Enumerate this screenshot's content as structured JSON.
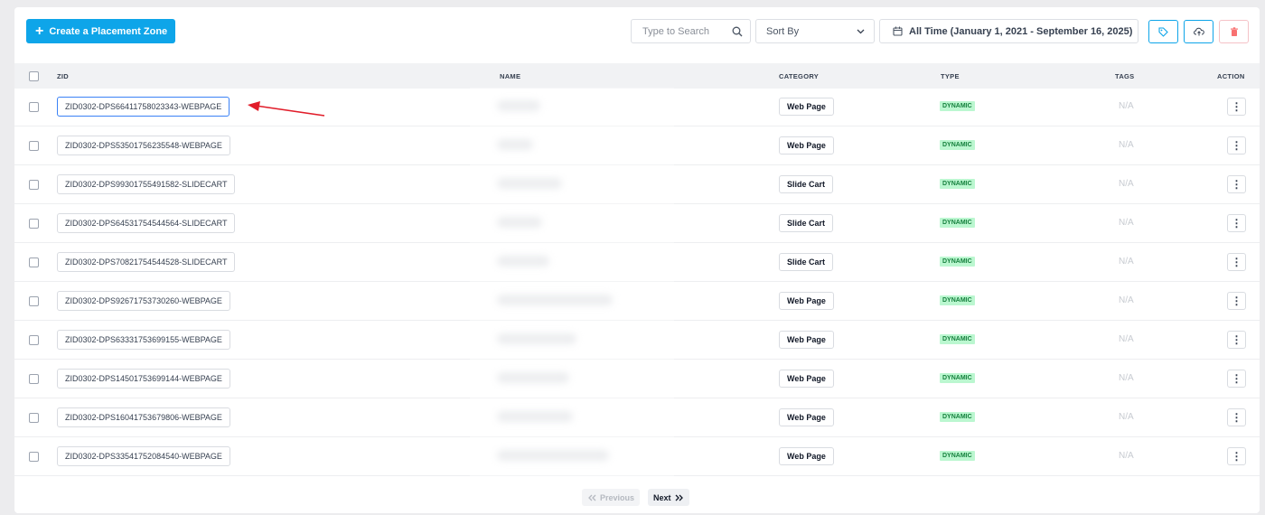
{
  "toolbar": {
    "create_label": "Create a Placement Zone",
    "search_placeholder": "Type to Search",
    "sort_label": "Sort By",
    "date_range": "All Time (January 1, 2021 - September 16, 2025)"
  },
  "table": {
    "columns": {
      "zid": "ZID",
      "name": "NAME",
      "category": "CATEGORY",
      "type": "TYPE",
      "tags": "TAGS",
      "action": "ACTION"
    },
    "rows": [
      {
        "zid": "ZID0302-DPS66411758023343-WEBPAGE",
        "category": "Web Page",
        "type": "DYNAMIC",
        "tags": "N/A"
      },
      {
        "zid": "ZID0302-DPS53501756235548-WEBPAGE",
        "category": "Web Page",
        "type": "DYNAMIC",
        "tags": "N/A"
      },
      {
        "zid": "ZID0302-DPS99301755491582-SLIDECART",
        "category": "Slide Cart",
        "type": "DYNAMIC",
        "tags": "N/A"
      },
      {
        "zid": "ZID0302-DPS64531754544564-SLIDECART",
        "category": "Slide Cart",
        "type": "DYNAMIC",
        "tags": "N/A"
      },
      {
        "zid": "ZID0302-DPS70821754544528-SLIDECART",
        "category": "Slide Cart",
        "type": "DYNAMIC",
        "tags": "N/A"
      },
      {
        "zid": "ZID0302-DPS92671753730260-WEBPAGE",
        "category": "Web Page",
        "type": "DYNAMIC",
        "tags": "N/A"
      },
      {
        "zid": "ZID0302-DPS63331753699155-WEBPAGE",
        "category": "Web Page",
        "type": "DYNAMIC",
        "tags": "N/A"
      },
      {
        "zid": "ZID0302-DPS14501753699144-WEBPAGE",
        "category": "Web Page",
        "type": "DYNAMIC",
        "tags": "N/A"
      },
      {
        "zid": "ZID0302-DPS16041753679806-WEBPAGE",
        "category": "Web Page",
        "type": "DYNAMIC",
        "tags": "N/A"
      },
      {
        "zid": "ZID0302-DPS33541752084540-WEBPAGE",
        "category": "Web Page",
        "type": "DYNAMIC",
        "tags": "N/A"
      }
    ]
  },
  "pagination": {
    "previous_label": "Previous",
    "next_label": "Next"
  },
  "colors": {
    "primary": "#0ea5e9",
    "dynamic_bg": "#bbf7d0",
    "dynamic_text": "#15803d",
    "annotation_arrow": "#e11d2a"
  },
  "icons": {
    "search": "search-icon",
    "sort": "chevron-down-icon",
    "date": "calendar-icon",
    "tag": "tag-icon",
    "upload": "cloud-upload-icon",
    "delete": "trash-icon",
    "action": "more-vertical-icon"
  }
}
